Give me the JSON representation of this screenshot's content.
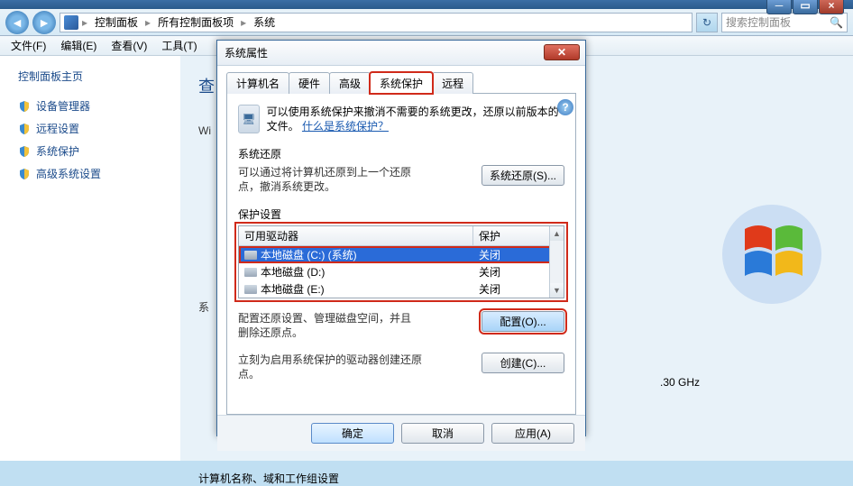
{
  "nav": {
    "crumb1": "控制面板",
    "crumb2": "所有控制面板项",
    "crumb3": "系统",
    "search_placeholder": "搜索控制面板"
  },
  "menu": {
    "file": "文件(F)",
    "edit": "编辑(E)",
    "view": "查看(V)",
    "tools": "工具(T)"
  },
  "sidebar": {
    "home": "控制面板主页",
    "items": [
      "设备管理器",
      "远程设置",
      "系统保护",
      "高级系统设置"
    ]
  },
  "main": {
    "bigtitle": "查",
    "wi": "Wi",
    "sysline": "系",
    "ghz": ".30 GHz",
    "bottom": "计算机名称、域和工作组设置"
  },
  "dialog": {
    "title": "系统属性",
    "tabs": {
      "computer": "计算机名",
      "hardware": "硬件",
      "advanced": "高级",
      "protect": "系统保护",
      "remote": "远程"
    },
    "intro_text": "可以使用系统保护来撤消不需要的系统更改，还原以前版本的文件。",
    "intro_link": "什么是系统保护？",
    "restore_heading": "系统还原",
    "restore_text": "可以通过将计算机还原到上一个还原点，撤消系统更改。",
    "restore_btn": "系统还原(S)...",
    "protect_heading": "保护设置",
    "col_drive": "可用驱动器",
    "col_protect": "保护",
    "drives": [
      {
        "name": "本地磁盘 (C:) (系统)",
        "status": "关闭"
      },
      {
        "name": "本地磁盘 (D:)",
        "status": "关闭"
      },
      {
        "name": "本地磁盘 (E:)",
        "status": "关闭"
      }
    ],
    "config_text": "配置还原设置、管理磁盘空间，并且删除还原点。",
    "config_btn": "配置(O)...",
    "create_text": "立刻为启用系统保护的驱动器创建还原点。",
    "create_btn": "创建(C)...",
    "ok": "确定",
    "cancel": "取消",
    "apply": "应用(A)"
  }
}
